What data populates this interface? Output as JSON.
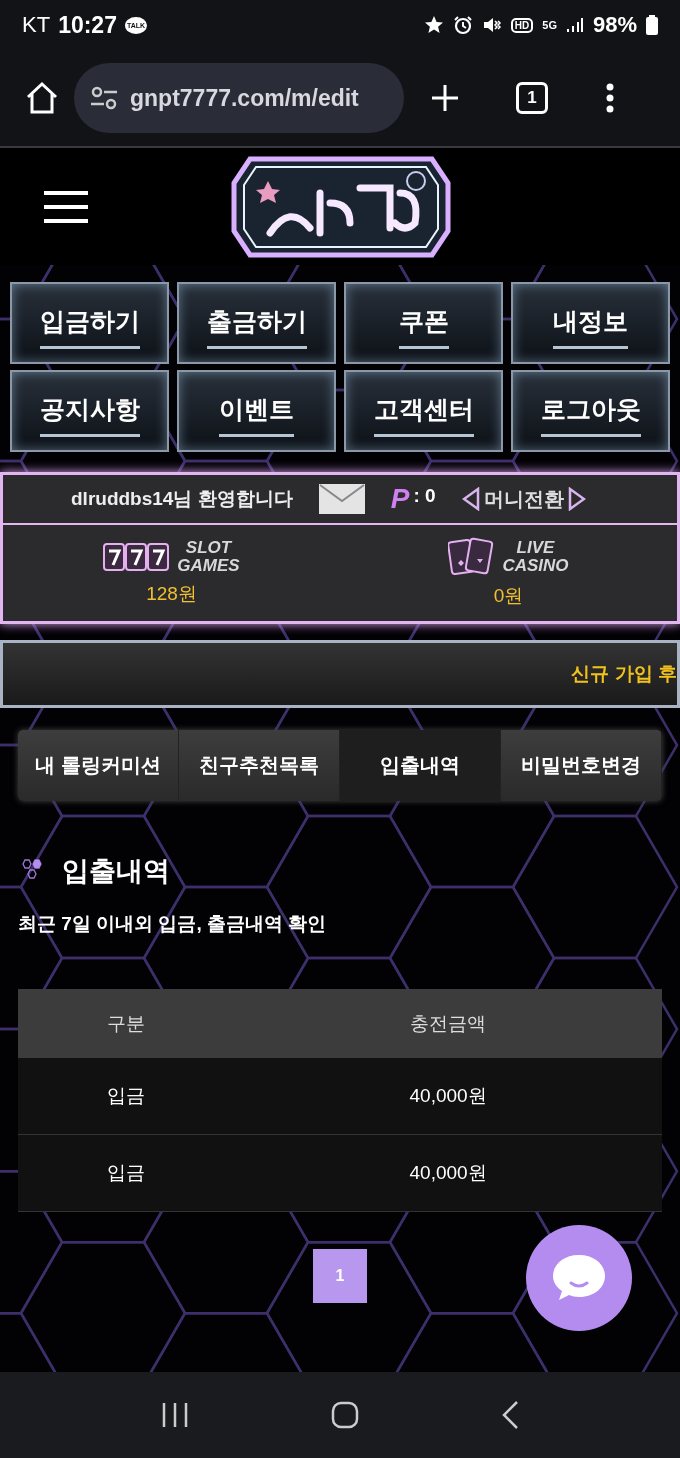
{
  "status_bar": {
    "carrier": "KT",
    "time": "10:27",
    "chat_badge": "TALK",
    "hd": "HD",
    "network": "5G",
    "battery": "98%"
  },
  "browser": {
    "url": "gnpt7777.com/m/edit",
    "tab_count": "1"
  },
  "menu": [
    {
      "label": "입금하기"
    },
    {
      "label": "출금하기"
    },
    {
      "label": "쿠폰"
    },
    {
      "label": "내정보"
    },
    {
      "label": "공지사항"
    },
    {
      "label": "이벤트"
    },
    {
      "label": "고객센터"
    },
    {
      "label": "로그아웃"
    }
  ],
  "user_panel": {
    "greeting": "dlruddbs14님 환영합니다",
    "points_label": "P",
    "points": ": 0",
    "money_transfer": "머니전환",
    "wallets": [
      {
        "kind": "slot",
        "title_1": "SLOT",
        "title_2": "GAMES",
        "amount": "128원"
      },
      {
        "kind": "casino",
        "title_1": "LIVE",
        "title_2": "CASINO",
        "amount": "0원"
      }
    ]
  },
  "notice": {
    "text": "신규 가입 후"
  },
  "tabs": [
    {
      "label": "내 롤링커미션",
      "selected": false
    },
    {
      "label": "친구추천목록",
      "selected": false
    },
    {
      "label": "입출내역",
      "selected": true
    },
    {
      "label": "비밀번호변경",
      "selected": false
    }
  ],
  "section": {
    "title": "입출내역",
    "description": "최근 7일 이내외 입금, 출금내역 확인"
  },
  "table": {
    "columns": [
      "구분",
      "충전금액"
    ],
    "rows": [
      [
        "입금",
        "40,000원"
      ],
      [
        "입금",
        "40,000원"
      ]
    ]
  },
  "pagination": [
    {
      "label": "1",
      "selected": true
    }
  ]
}
